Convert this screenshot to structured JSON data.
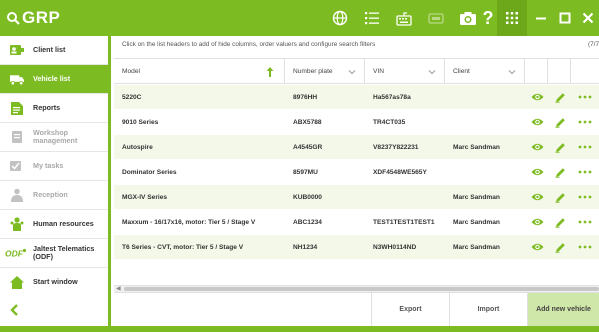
{
  "app": {
    "title": "GRP"
  },
  "colors": {
    "brand": "#7dbb22",
    "row_alt": "#f3f8e8",
    "accent_btn": "#cfe7a8"
  },
  "toolbar": {
    "icons": [
      "globe-icon",
      "list-icon",
      "keyboard-icon",
      "card-reader-icon",
      "camera-icon",
      "help-icon",
      "apps-grid-icon"
    ],
    "window_controls": [
      "minimize-icon",
      "maximize-icon",
      "close-icon"
    ]
  },
  "sidebar": {
    "items": [
      {
        "label": "Client list",
        "icon": "client-card-icon",
        "active": false,
        "disabled": false
      },
      {
        "label": "Vehicle list",
        "icon": "vehicle-icon",
        "active": true,
        "disabled": false
      },
      {
        "label": "Reports",
        "icon": "reports-icon",
        "active": false,
        "disabled": false
      },
      {
        "label": "Workshop management",
        "icon": "workshop-icon",
        "active": false,
        "disabled": true
      },
      {
        "label": "My tasks",
        "icon": "tasks-icon",
        "active": false,
        "disabled": true
      },
      {
        "label": "Reception",
        "icon": "reception-icon",
        "active": false,
        "disabled": true
      },
      {
        "label": "Human resources",
        "icon": "people-icon",
        "active": false,
        "disabled": false
      },
      {
        "label": "Jaltest Telematics (ODF)",
        "icon": "odf-icon",
        "active": false,
        "disabled": false
      },
      {
        "label": "Start window",
        "icon": "home-icon",
        "active": false,
        "disabled": false
      }
    ]
  },
  "main": {
    "hint": "Click on the list headers to add of hide columns, order valuers and configure search filters",
    "pager": "(7/7",
    "columns": [
      "Model",
      "Number plate",
      "VIN",
      "Client"
    ],
    "rows": [
      {
        "model": "5220C",
        "plate": "8976HH",
        "vin": "Ha567as78a",
        "client": ""
      },
      {
        "model": "9010 Series",
        "plate": "ABX5788",
        "vin": "TR4CT035",
        "client": ""
      },
      {
        "model": "Autospire",
        "plate": "A4545GR",
        "vin": "V8237Y822231",
        "client": "Marc Sandman"
      },
      {
        "model": "Dominator Series",
        "plate": "8597MU",
        "vin": "XDF4548WE565Y",
        "client": ""
      },
      {
        "model": "MGX-IV Series",
        "plate": "KUB0000",
        "vin": "",
        "client": "Marc Sandman"
      },
      {
        "model": "Maxxum - 16/17x16, motor: Tier 5 / Stage V",
        "plate": "ABC1234",
        "vin": "TEST1TEST1TEST1",
        "client": "Marc Sandman"
      },
      {
        "model": "T6 Series - CVT, motor: Tier 5 / Stage V",
        "plate": "NH1234",
        "vin": "N3WH0114ND",
        "client": "Marc Sandman"
      }
    ],
    "row_actions": [
      "view-eye-icon",
      "edit-pencil-icon",
      "more-dots-icon"
    ]
  },
  "footer": {
    "export": "Export",
    "import": "Import",
    "add": "Add new vehicle"
  }
}
